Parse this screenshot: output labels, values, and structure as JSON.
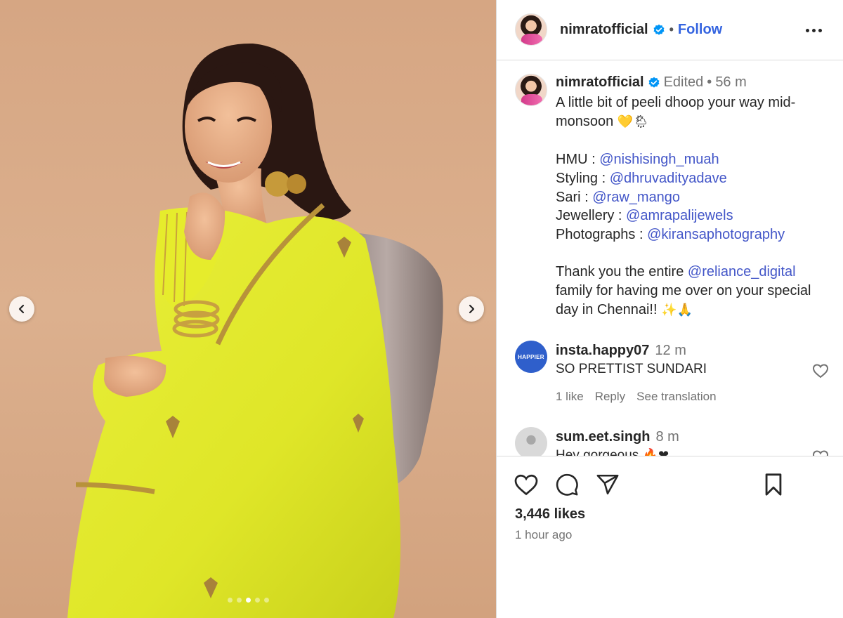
{
  "post": {
    "username": "nimratofficial",
    "follow_label": "Follow",
    "separator": "•",
    "carousel": {
      "total_slides": 5,
      "active_slide": 3
    }
  },
  "caption": {
    "username": "nimratofficial",
    "edited_label": "Edited",
    "separator": "•",
    "time": "56 m",
    "line1": "A little bit of peeli dhoop your way mid-monsoon",
    "line1_emoji": "💛🌦",
    "credits": [
      {
        "label": "HMU : ",
        "mention": "@nishisingh_muah"
      },
      {
        "label": "Styling : ",
        "mention": "@dhruvadityadave"
      },
      {
        "label": "Sari : ",
        "mention": "@raw_mango"
      },
      {
        "label": "Jewellery : ",
        "mention": "@amrapalijewels"
      },
      {
        "label": "Photographs : ",
        "mention": "@kiransaphotography"
      }
    ],
    "thanks_prefix": "Thank you the entire ",
    "thanks_mention": "@reliance_digital",
    "thanks_suffix": " family for having me over on your special day in Chennai!!",
    "thanks_emoji": "✨🙏"
  },
  "comments": [
    {
      "username": "insta.happy07",
      "avatar_text": "HAPPIER",
      "time": "12 m",
      "text": "SO PRETTIST SUNDARI",
      "likes": "1 like",
      "reply_label": "Reply",
      "translation_label": "See translation"
    },
    {
      "username": "sum.eet.singh",
      "time": "8 m",
      "text": "Hey gorgeous",
      "text_emoji": "🔥❤"
    }
  ],
  "footer": {
    "likes": "3,446 likes",
    "time_ago": "1 hour ago"
  },
  "icons": {
    "verified": "verified-badge-icon",
    "more": "more-options-icon",
    "like": "heart-icon",
    "comment": "comment-icon",
    "share": "share-icon",
    "save": "bookmark-icon",
    "prev": "chevron-left-icon",
    "next": "chevron-right-icon"
  },
  "colors": {
    "link": "#4356c8",
    "verified": "#0095f6",
    "follow": "#3464e0",
    "saree": "#e3ea33",
    "backdrop": "#d7a987"
  }
}
